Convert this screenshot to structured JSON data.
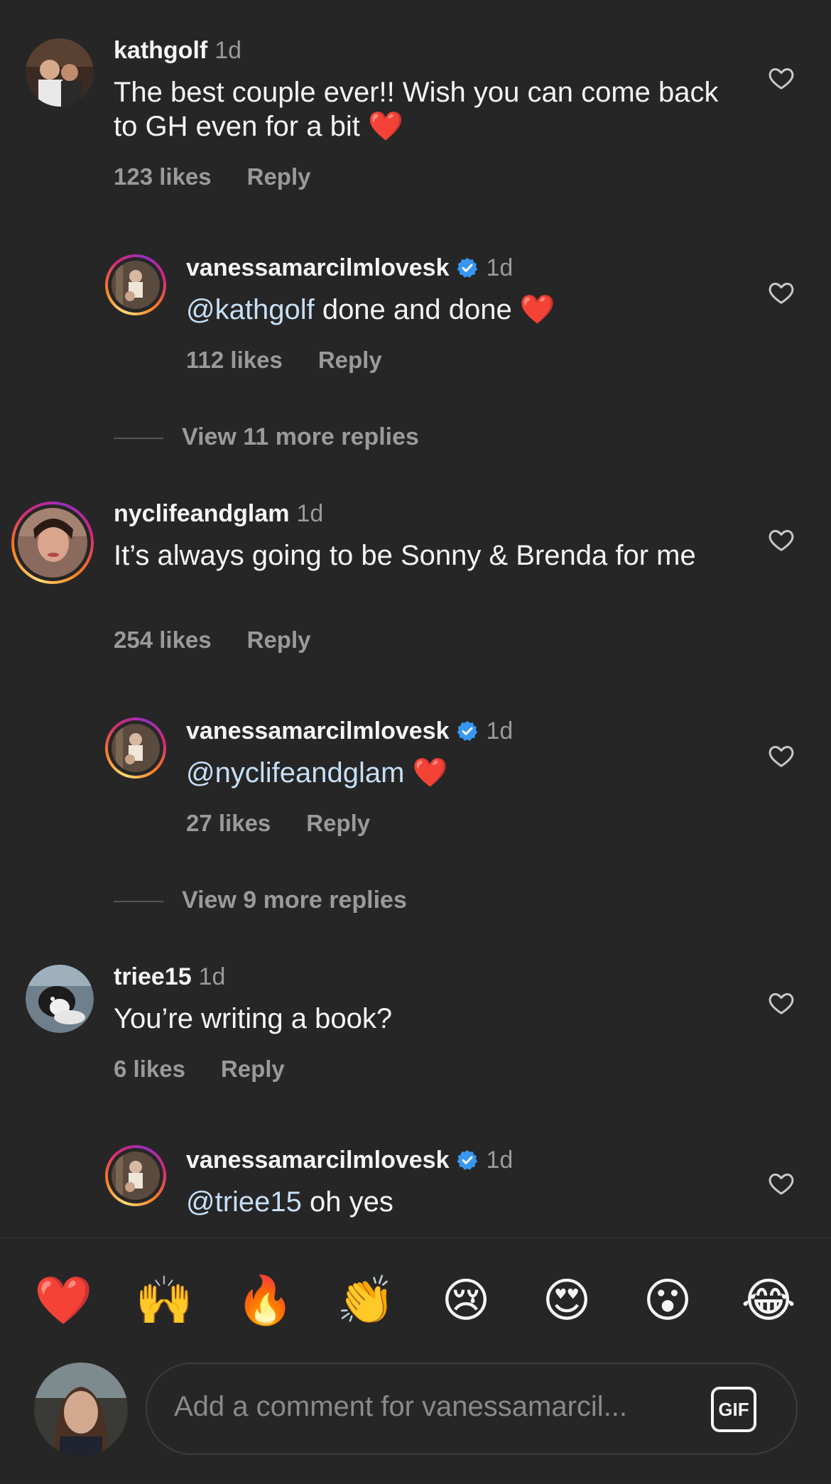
{
  "comments": [
    {
      "username": "kathgolf",
      "time": "1d",
      "text": "The best couple ever!! Wish you can come back to GH even for a bit",
      "emoji": "❤️",
      "likes": "123 likes",
      "reply": "Reply"
    },
    {
      "username": "vanessamarcilmlovesk",
      "time": "1d",
      "mention": "@kathgolf",
      "text": " done and done ",
      "emoji": "❤️",
      "likes": "112 likes",
      "reply": "Reply"
    },
    {
      "more": "View 11 more replies"
    },
    {
      "username": "nyclifeandglam",
      "time": "1d",
      "text": "It’s always going to be Sonny & Brenda for me",
      "likes": "254 likes",
      "reply": "Reply"
    },
    {
      "username": "vanessamarcilmlovesk",
      "time": "1d",
      "mention": "@nyclifeandglam",
      "text": " ",
      "emoji": "❤️",
      "likes": "27 likes",
      "reply": "Reply"
    },
    {
      "more": "View 9 more replies"
    },
    {
      "username": "triee15",
      "time": "1d",
      "text": "You’re writing a book?",
      "likes": "6 likes",
      "reply": "Reply"
    },
    {
      "username": "vanessamarcilmlovesk",
      "time": "1d",
      "mention": "@triee15",
      "text": " oh yes"
    }
  ],
  "reactions": [
    "❤️",
    "🙌",
    "🔥",
    "👏",
    "😢",
    "😍",
    "😮",
    "😂"
  ],
  "composer": {
    "placeholder": "Add a comment for vanessamarcil...",
    "gif_label": "GIF"
  },
  "colors": {
    "background": "#262626",
    "mention": "#c7def6",
    "verified": "#3897f0"
  },
  "icons": {
    "like": "heart-outline-icon",
    "verified": "verified-badge-icon"
  }
}
